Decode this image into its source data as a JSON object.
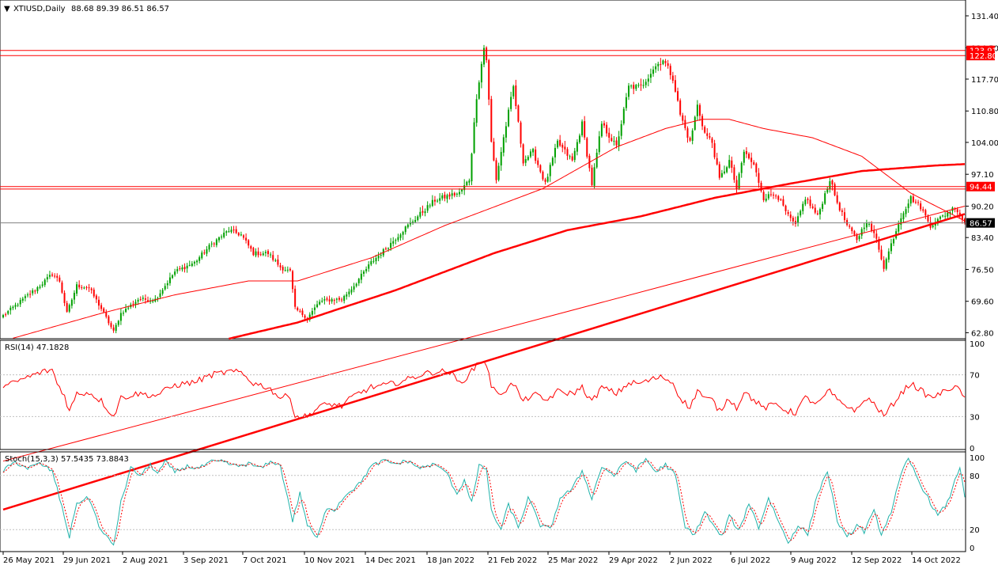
{
  "header": {
    "symbol": "XTIUSD,Daily",
    "ohlc": "88.68 89.39 86.51 86.57"
  },
  "colors": {
    "bull": "#00a000",
    "bear": "#ff0000",
    "ma": "#ff0000",
    "level": "#ff0000",
    "rsi": "#ff0000",
    "stoch_main": "#20b2aa",
    "stoch_signal": "#ff0000",
    "current_price_box": "#000000",
    "grid_dash": "#c0c0c0"
  },
  "chart_data": [
    {
      "type": "candlestick",
      "title": "XTIUSD,Daily",
      "subtitle": "88.68 89.39 86.51 86.57",
      "x_tick_labels": [
        "26 May 2021",
        "29 Jun 2021",
        "2 Aug 2021",
        "3 Sep 2021",
        "7 Oct 2021",
        "10 Nov 2021",
        "14 Dec 2021",
        "18 Jan 2022",
        "21 Feb 2022",
        "25 Mar 2022",
        "29 Apr 2022",
        "2 Jun 2022",
        "6 Jul 2022",
        "9 Aug 2022",
        "12 Sep 2022",
        "14 Oct 2022"
      ],
      "y_tick_labels": [
        "131.40",
        "124.50",
        "117.70",
        "110.80",
        "104.00",
        "97.10",
        "90.20",
        "83.40",
        "76.50",
        "69.60",
        "62.80"
      ],
      "ylim": [
        61.5,
        133.8
      ],
      "price_levels": [
        {
          "value": 123.91,
          "label": "123.91"
        },
        {
          "value": 122.8,
          "label": "122.80"
        },
        {
          "value": 94.44,
          "label": "94.44"
        },
        {
          "value": 93.9,
          "label": ""
        }
      ],
      "current_price": {
        "value": 86.57,
        "label": "86.57"
      },
      "anchors": [
        [
          0,
          66.5
        ],
        [
          8,
          70
        ],
        [
          15,
          73
        ],
        [
          20,
          75.5
        ],
        [
          23,
          74
        ],
        [
          26,
          67
        ],
        [
          30,
          73
        ],
        [
          35,
          72.5
        ],
        [
          40,
          68
        ],
        [
          45,
          63
        ],
        [
          48,
          67
        ],
        [
          55,
          70
        ],
        [
          62,
          70
        ],
        [
          70,
          76
        ],
        [
          78,
          78
        ],
        [
          85,
          82
        ],
        [
          92,
          85
        ],
        [
          97,
          84
        ],
        [
          102,
          80
        ],
        [
          108,
          80
        ],
        [
          113,
          77
        ],
        [
          117,
          76
        ],
        [
          119,
          68
        ],
        [
          124,
          66
        ],
        [
          129,
          69.5
        ],
        [
          134,
          70
        ],
        [
          138,
          70
        ],
        [
          143,
          73
        ],
        [
          150,
          78
        ],
        [
          156,
          81
        ],
        [
          163,
          85
        ],
        [
          170,
          88.5
        ],
        [
          176,
          91.5
        ],
        [
          182,
          92.5
        ],
        [
          186,
          93
        ],
        [
          190,
          96
        ],
        [
          193,
          114
        ],
        [
          196,
          124.5
        ],
        [
          197,
          122
        ],
        [
          199,
          104
        ],
        [
          201,
          96
        ],
        [
          204,
          105
        ],
        [
          208,
          116
        ],
        [
          212,
          100
        ],
        [
          216,
          102
        ],
        [
          221,
          95
        ],
        [
          226,
          104
        ],
        [
          232,
          100
        ],
        [
          236,
          108
        ],
        [
          240,
          95
        ],
        [
          244,
          108
        ],
        [
          250,
          103
        ],
        [
          255,
          116
        ],
        [
          260,
          116
        ],
        [
          265,
          120
        ],
        [
          269,
          122
        ],
        [
          273,
          118
        ],
        [
          276,
          110
        ],
        [
          280,
          104
        ],
        [
          283,
          112
        ],
        [
          286,
          106
        ],
        [
          289,
          104
        ],
        [
          292,
          96
        ],
        [
          296,
          100
        ],
        [
          299,
          94
        ],
        [
          302,
          102
        ],
        [
          306,
          99
        ],
        [
          310,
          92
        ],
        [
          315,
          93
        ],
        [
          320,
          88
        ],
        [
          323,
          86
        ],
        [
          327,
          92
        ],
        [
          332,
          88
        ],
        [
          337,
          96
        ],
        [
          340,
          91
        ],
        [
          344,
          86
        ],
        [
          348,
          83
        ],
        [
          352,
          87
        ],
        [
          356,
          83
        ],
        [
          359,
          77
        ],
        [
          362,
          82
        ],
        [
          366,
          88
        ],
        [
          370,
          92
        ],
        [
          374,
          90
        ],
        [
          378,
          86
        ],
        [
          383,
          88
        ],
        [
          388,
          90
        ],
        [
          392,
          86.6
        ]
      ],
      "moving_averages": [
        {
          "name": "",
          "points": [
            [
              0,
              61
            ],
            [
              40,
              67
            ],
            [
              70,
              71
            ],
            [
              100,
              74
            ],
            [
              120,
              74
            ],
            [
              150,
              79
            ],
            [
              180,
              86
            ],
            [
              200,
              90
            ],
            [
              220,
              94
            ],
            [
              250,
              103
            ],
            [
              270,
              107
            ],
            [
              285,
              109
            ],
            [
              296,
              109
            ],
            [
              310,
              107
            ],
            [
              330,
              105
            ],
            [
              350,
              101
            ],
            [
              370,
              93
            ],
            [
              392,
              87
            ]
          ]
        },
        {
          "name": "",
          "points": [
            [
              0,
              44
            ],
            [
              40,
              52
            ],
            [
              80,
              60
            ],
            [
              120,
              65
            ],
            [
              160,
              72
            ],
            [
              180,
              76
            ],
            [
              200,
              80
            ],
            [
              230,
              85
            ],
            [
              260,
              88
            ],
            [
              290,
              92
            ],
            [
              320,
              95
            ],
            [
              350,
              97.8
            ],
            [
              380,
              99
            ],
            [
              392,
              99.3
            ]
          ]
        }
      ],
      "trendlines": [
        {
          "name": "",
          "points": [
            [
              0,
              24.5
            ],
            [
              392,
              88.5
            ]
          ]
        },
        {
          "name": "",
          "points": [
            [
              0,
              35
            ],
            [
              392,
              90.2
            ]
          ]
        }
      ]
    },
    {
      "type": "line",
      "title": "RSI(14) 47.1828",
      "y_tick_labels": [
        "100",
        "70",
        "30",
        "0"
      ],
      "ylim": [
        0,
        100
      ],
      "levels": [
        70,
        30
      ],
      "anchors": [
        [
          0,
          58
        ],
        [
          8,
          66
        ],
        [
          15,
          72
        ],
        [
          20,
          75
        ],
        [
          22,
          62
        ],
        [
          25,
          50
        ],
        [
          27,
          35
        ],
        [
          30,
          52
        ],
        [
          35,
          53
        ],
        [
          40,
          45
        ],
        [
          45,
          30
        ],
        [
          48,
          48
        ],
        [
          55,
          52
        ],
        [
          62,
          50
        ],
        [
          70,
          60
        ],
        [
          78,
          63
        ],
        [
          85,
          70
        ],
        [
          92,
          73
        ],
        [
          97,
          72
        ],
        [
          102,
          62
        ],
        [
          108,
          58
        ],
        [
          113,
          48
        ],
        [
          117,
          50
        ],
        [
          119,
          30
        ],
        [
          124,
          30
        ],
        [
          129,
          40
        ],
        [
          134,
          42
        ],
        [
          138,
          40
        ],
        [
          143,
          50
        ],
        [
          150,
          58
        ],
        [
          156,
          60
        ],
        [
          163,
          64
        ],
        [
          170,
          70
        ],
        [
          176,
          73
        ],
        [
          182,
          73
        ],
        [
          186,
          62
        ],
        [
          190,
          70
        ],
        [
          193,
          80
        ],
        [
          196,
          84
        ],
        [
          197,
          80
        ],
        [
          199,
          60
        ],
        [
          201,
          52
        ],
        [
          204,
          54
        ],
        [
          208,
          62
        ],
        [
          212,
          44
        ],
        [
          216,
          52
        ],
        [
          221,
          45
        ],
        [
          226,
          54
        ],
        [
          232,
          52
        ],
        [
          236,
          58
        ],
        [
          240,
          44
        ],
        [
          244,
          58
        ],
        [
          250,
          52
        ],
        [
          255,
          62
        ],
        [
          260,
          62
        ],
        [
          265,
          66
        ],
        [
          269,
          68
        ],
        [
          273,
          62
        ],
        [
          276,
          48
        ],
        [
          280,
          38
        ],
        [
          283,
          56
        ],
        [
          286,
          47
        ],
        [
          289,
          46
        ],
        [
          292,
          35
        ],
        [
          296,
          48
        ],
        [
          299,
          38
        ],
        [
          302,
          54
        ],
        [
          306,
          46
        ],
        [
          310,
          38
        ],
        [
          315,
          42
        ],
        [
          320,
          35
        ],
        [
          323,
          34
        ],
        [
          327,
          48
        ],
        [
          332,
          42
        ],
        [
          337,
          55
        ],
        [
          340,
          45
        ],
        [
          344,
          40
        ],
        [
          348,
          36
        ],
        [
          352,
          48
        ],
        [
          356,
          40
        ],
        [
          359,
          30
        ],
        [
          362,
          40
        ],
        [
          366,
          52
        ],
        [
          370,
          62
        ],
        [
          374,
          55
        ],
        [
          378,
          48
        ],
        [
          383,
          53
        ],
        [
          388,
          60
        ],
        [
          392,
          47.18
        ]
      ]
    },
    {
      "type": "line",
      "title": "Stoch(15,3,3) 57.5435 73.8843",
      "y_tick_labels": [
        "100",
        "80",
        "20",
        "0"
      ],
      "ylim": [
        0,
        100
      ],
      "levels": [
        80,
        20
      ],
      "anchors": [
        [
          0,
          85
        ],
        [
          5,
          95
        ],
        [
          10,
          88
        ],
        [
          15,
          93
        ],
        [
          20,
          85
        ],
        [
          23,
          55
        ],
        [
          27,
          12
        ],
        [
          30,
          50
        ],
        [
          35,
          55
        ],
        [
          40,
          18
        ],
        [
          45,
          3
        ],
        [
          48,
          50
        ],
        [
          52,
          88
        ],
        [
          56,
          80
        ],
        [
          60,
          92
        ],
        [
          63,
          82
        ],
        [
          66,
          95
        ],
        [
          70,
          84
        ],
        [
          75,
          90
        ],
        [
          80,
          88
        ],
        [
          85,
          95
        ],
        [
          90,
          95
        ],
        [
          95,
          90
        ],
        [
          100,
          93
        ],
        [
          105,
          88
        ],
        [
          110,
          96
        ],
        [
          113,
          90
        ],
        [
          116,
          55
        ],
        [
          118,
          30
        ],
        [
          121,
          60
        ],
        [
          124,
          25
        ],
        [
          128,
          10
        ],
        [
          132,
          45
        ],
        [
          135,
          42
        ],
        [
          140,
          60
        ],
        [
          145,
          70
        ],
        [
          150,
          90
        ],
        [
          155,
          96
        ],
        [
          160,
          93
        ],
        [
          165,
          96
        ],
        [
          170,
          88
        ],
        [
          175,
          92
        ],
        [
          180,
          86
        ],
        [
          185,
          60
        ],
        [
          188,
          75
        ],
        [
          191,
          50
        ],
        [
          194,
          90
        ],
        [
          197,
          88
        ],
        [
          199,
          40
        ],
        [
          203,
          20
        ],
        [
          206,
          48
        ],
        [
          210,
          22
        ],
        [
          214,
          55
        ],
        [
          219,
          25
        ],
        [
          223,
          20
        ],
        [
          227,
          55
        ],
        [
          232,
          65
        ],
        [
          236,
          85
        ],
        [
          240,
          55
        ],
        [
          244,
          90
        ],
        [
          249,
          80
        ],
        [
          254,
          96
        ],
        [
          258,
          86
        ],
        [
          262,
          98
        ],
        [
          266,
          84
        ],
        [
          270,
          92
        ],
        [
          274,
          80
        ],
        [
          278,
          22
        ],
        [
          282,
          15
        ],
        [
          286,
          40
        ],
        [
          290,
          22
        ],
        [
          293,
          12
        ],
        [
          296,
          35
        ],
        [
          300,
          18
        ],
        [
          304,
          50
        ],
        [
          308,
          22
        ],
        [
          312,
          55
        ],
        [
          316,
          30
        ],
        [
          320,
          5
        ],
        [
          324,
          25
        ],
        [
          328,
          15
        ],
        [
          332,
          60
        ],
        [
          336,
          85
        ],
        [
          340,
          30
        ],
        [
          344,
          10
        ],
        [
          348,
          25
        ],
        [
          351,
          18
        ],
        [
          355,
          40
        ],
        [
          358,
          15
        ],
        [
          362,
          40
        ],
        [
          366,
          80
        ],
        [
          369,
          99
        ],
        [
          373,
          75
        ],
        [
          377,
          55
        ],
        [
          381,
          35
        ],
        [
          385,
          50
        ],
        [
          390,
          90
        ],
        [
          392,
          57.54
        ]
      ],
      "signal_lag": 1.5
    }
  ]
}
